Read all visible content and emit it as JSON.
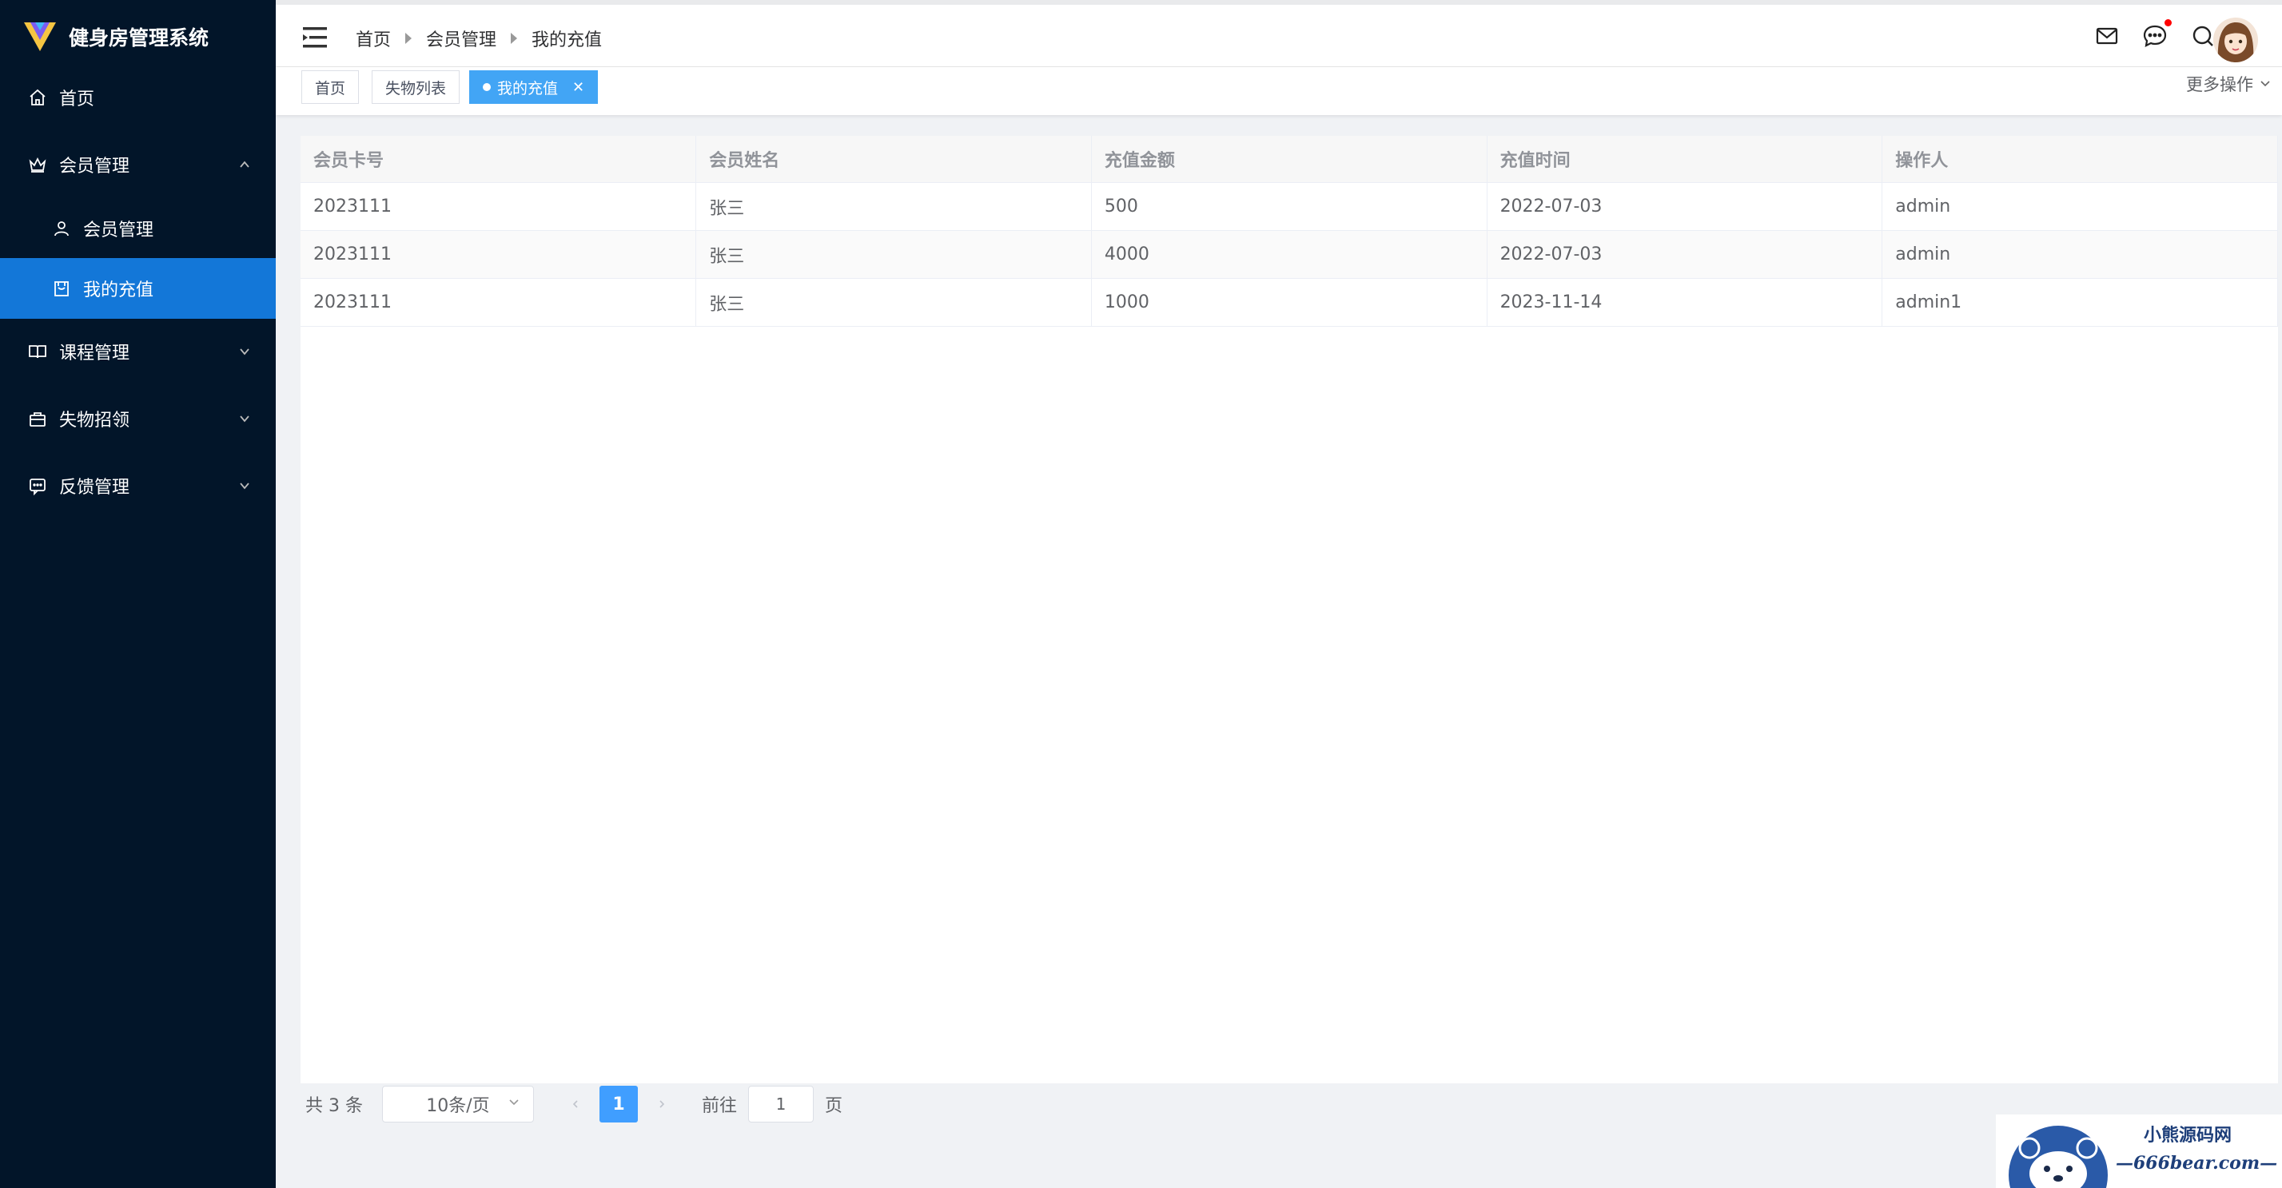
{
  "app": {
    "title": "健身房管理系统"
  },
  "sidebar": {
    "items": [
      {
        "label": "首页",
        "icon": "home-icon"
      },
      {
        "label": "会员管理",
        "icon": "crown-icon",
        "expanded": true
      },
      {
        "label": "会员管理",
        "icon": "user-icon",
        "sub": true
      },
      {
        "label": "我的充值",
        "icon": "calendar-icon",
        "sub": true,
        "active": true
      },
      {
        "label": "课程管理",
        "icon": "book-icon"
      },
      {
        "label": "失物招领",
        "icon": "bag-icon"
      },
      {
        "label": "反馈管理",
        "icon": "chat-icon"
      }
    ],
    "active_color": "#1377d8",
    "bg_color": "#021529"
  },
  "header": {
    "breadcrumb": [
      "首页",
      "会员管理",
      "我的充值"
    ],
    "icons": [
      "mail-icon",
      "message-icon",
      "search-icon",
      "avatar"
    ]
  },
  "tags": {
    "items": [
      {
        "label": "首页"
      },
      {
        "label": "失物列表"
      },
      {
        "label": "我的充值",
        "active": true
      }
    ],
    "more_ops": "更多操作"
  },
  "table": {
    "columns": [
      "会员卡号",
      "会员姓名",
      "充值金额",
      "充值时间",
      "操作人"
    ],
    "rows": [
      [
        "2023111",
        "张三",
        "500",
        "2022-07-03",
        "admin"
      ],
      [
        "2023111",
        "张三",
        "4000",
        "2022-07-03",
        "admin"
      ],
      [
        "2023111",
        "张三",
        "1000",
        "2023-11-14",
        "admin1"
      ]
    ]
  },
  "pagination": {
    "total": "共 3 条",
    "page_size": "10条/页",
    "current_page": "1",
    "goto_label": "前往",
    "goto_value": "1",
    "page_suffix": "页",
    "accent_color": "#409eff"
  },
  "watermark": {
    "line1": "小熊源码网",
    "line2": "—666bear.com—"
  }
}
